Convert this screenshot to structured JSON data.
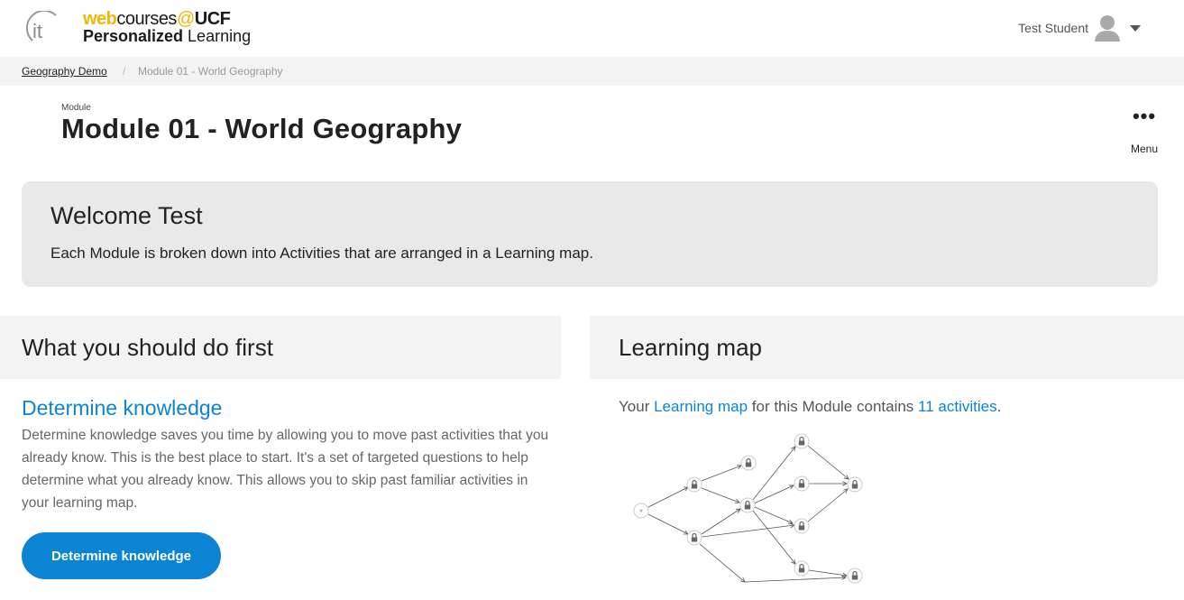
{
  "header": {
    "logo_text": "it",
    "brand": {
      "web": "web",
      "courses": "courses",
      "at": "@",
      "ucf": "UCF",
      "personalized": "Personalized",
      "learning": " Learning"
    },
    "user_name": "Test Student"
  },
  "breadcrumb": {
    "course": "Geography Demo",
    "separator": "/",
    "current": "Module 01 - World Geography"
  },
  "page": {
    "module_label": "Module",
    "title": "Module 01 - World Geography",
    "menu_label": "Menu"
  },
  "welcome": {
    "title": "Welcome Test",
    "text": "Each Module is broken down into Activities that are arranged in a Learning map."
  },
  "first_section": {
    "heading": "What you should do first",
    "link": "Determine knowledge",
    "description": "Determine knowledge saves you time by allowing you to move past activities that you already know. This is the best place to start.  It's a set of targeted questions to help determine what you already know. This allows you to skip past familiar activities in your learning map.",
    "button": "Determine knowledge"
  },
  "map_section": {
    "heading": "Learning map",
    "intro_prefix": "Your ",
    "intro_link": "Learning map",
    "intro_middle": " for this Module contains ",
    "activities_link": "11 activities",
    "intro_suffix": ".",
    "node_icon": "lock-icon",
    "start_icon": "start-dot-icon"
  },
  "colors": {
    "accent": "#0b84d3",
    "brand_gold": "#f2b705",
    "panel": "#e9e9e9"
  }
}
